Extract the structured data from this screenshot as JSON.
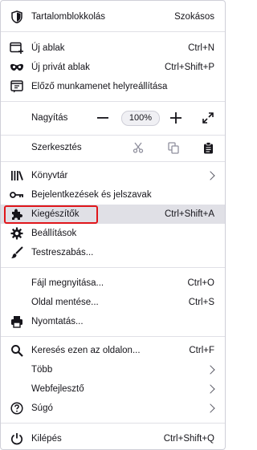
{
  "top": {
    "label": "Tartalomblokkolás",
    "value": "Szokásos"
  },
  "new_window": {
    "label": "Új ablak",
    "shortcut": "Ctrl+N"
  },
  "private_window": {
    "label": "Új privát ablak",
    "shortcut": "Ctrl+Shift+P"
  },
  "restore_session": {
    "label": "Előző munkamenet helyreállítása"
  },
  "zoom": {
    "label": "Nagyítás",
    "minus": "—",
    "level": "100%",
    "plus": "+"
  },
  "edit": {
    "label": "Szerkesztés"
  },
  "library": {
    "label": "Könyvtár"
  },
  "logins": {
    "label": "Bejelentkezések és jelszavak"
  },
  "addons": {
    "label": "Kiegészítők",
    "shortcut": "Ctrl+Shift+A"
  },
  "settings": {
    "label": "Beállítások"
  },
  "customize": {
    "label": "Testreszabás..."
  },
  "open_file": {
    "label": "Fájl megnyitása...",
    "shortcut": "Ctrl+O"
  },
  "save_page": {
    "label": "Oldal mentése...",
    "shortcut": "Ctrl+S"
  },
  "print": {
    "label": "Nyomtatás..."
  },
  "find": {
    "label": "Keresés ezen az oldalon...",
    "shortcut": "Ctrl+F"
  },
  "more": {
    "label": "Több"
  },
  "webdev": {
    "label": "Webfejlesztő"
  },
  "help": {
    "label": "Súgó"
  },
  "exit": {
    "label": "Kilépés",
    "shortcut": "Ctrl+Shift+Q"
  },
  "colors": {
    "text": "#15141a",
    "separator": "#e0e0e6",
    "hover": "#e0e0e6",
    "annotation": "#e0161b"
  }
}
